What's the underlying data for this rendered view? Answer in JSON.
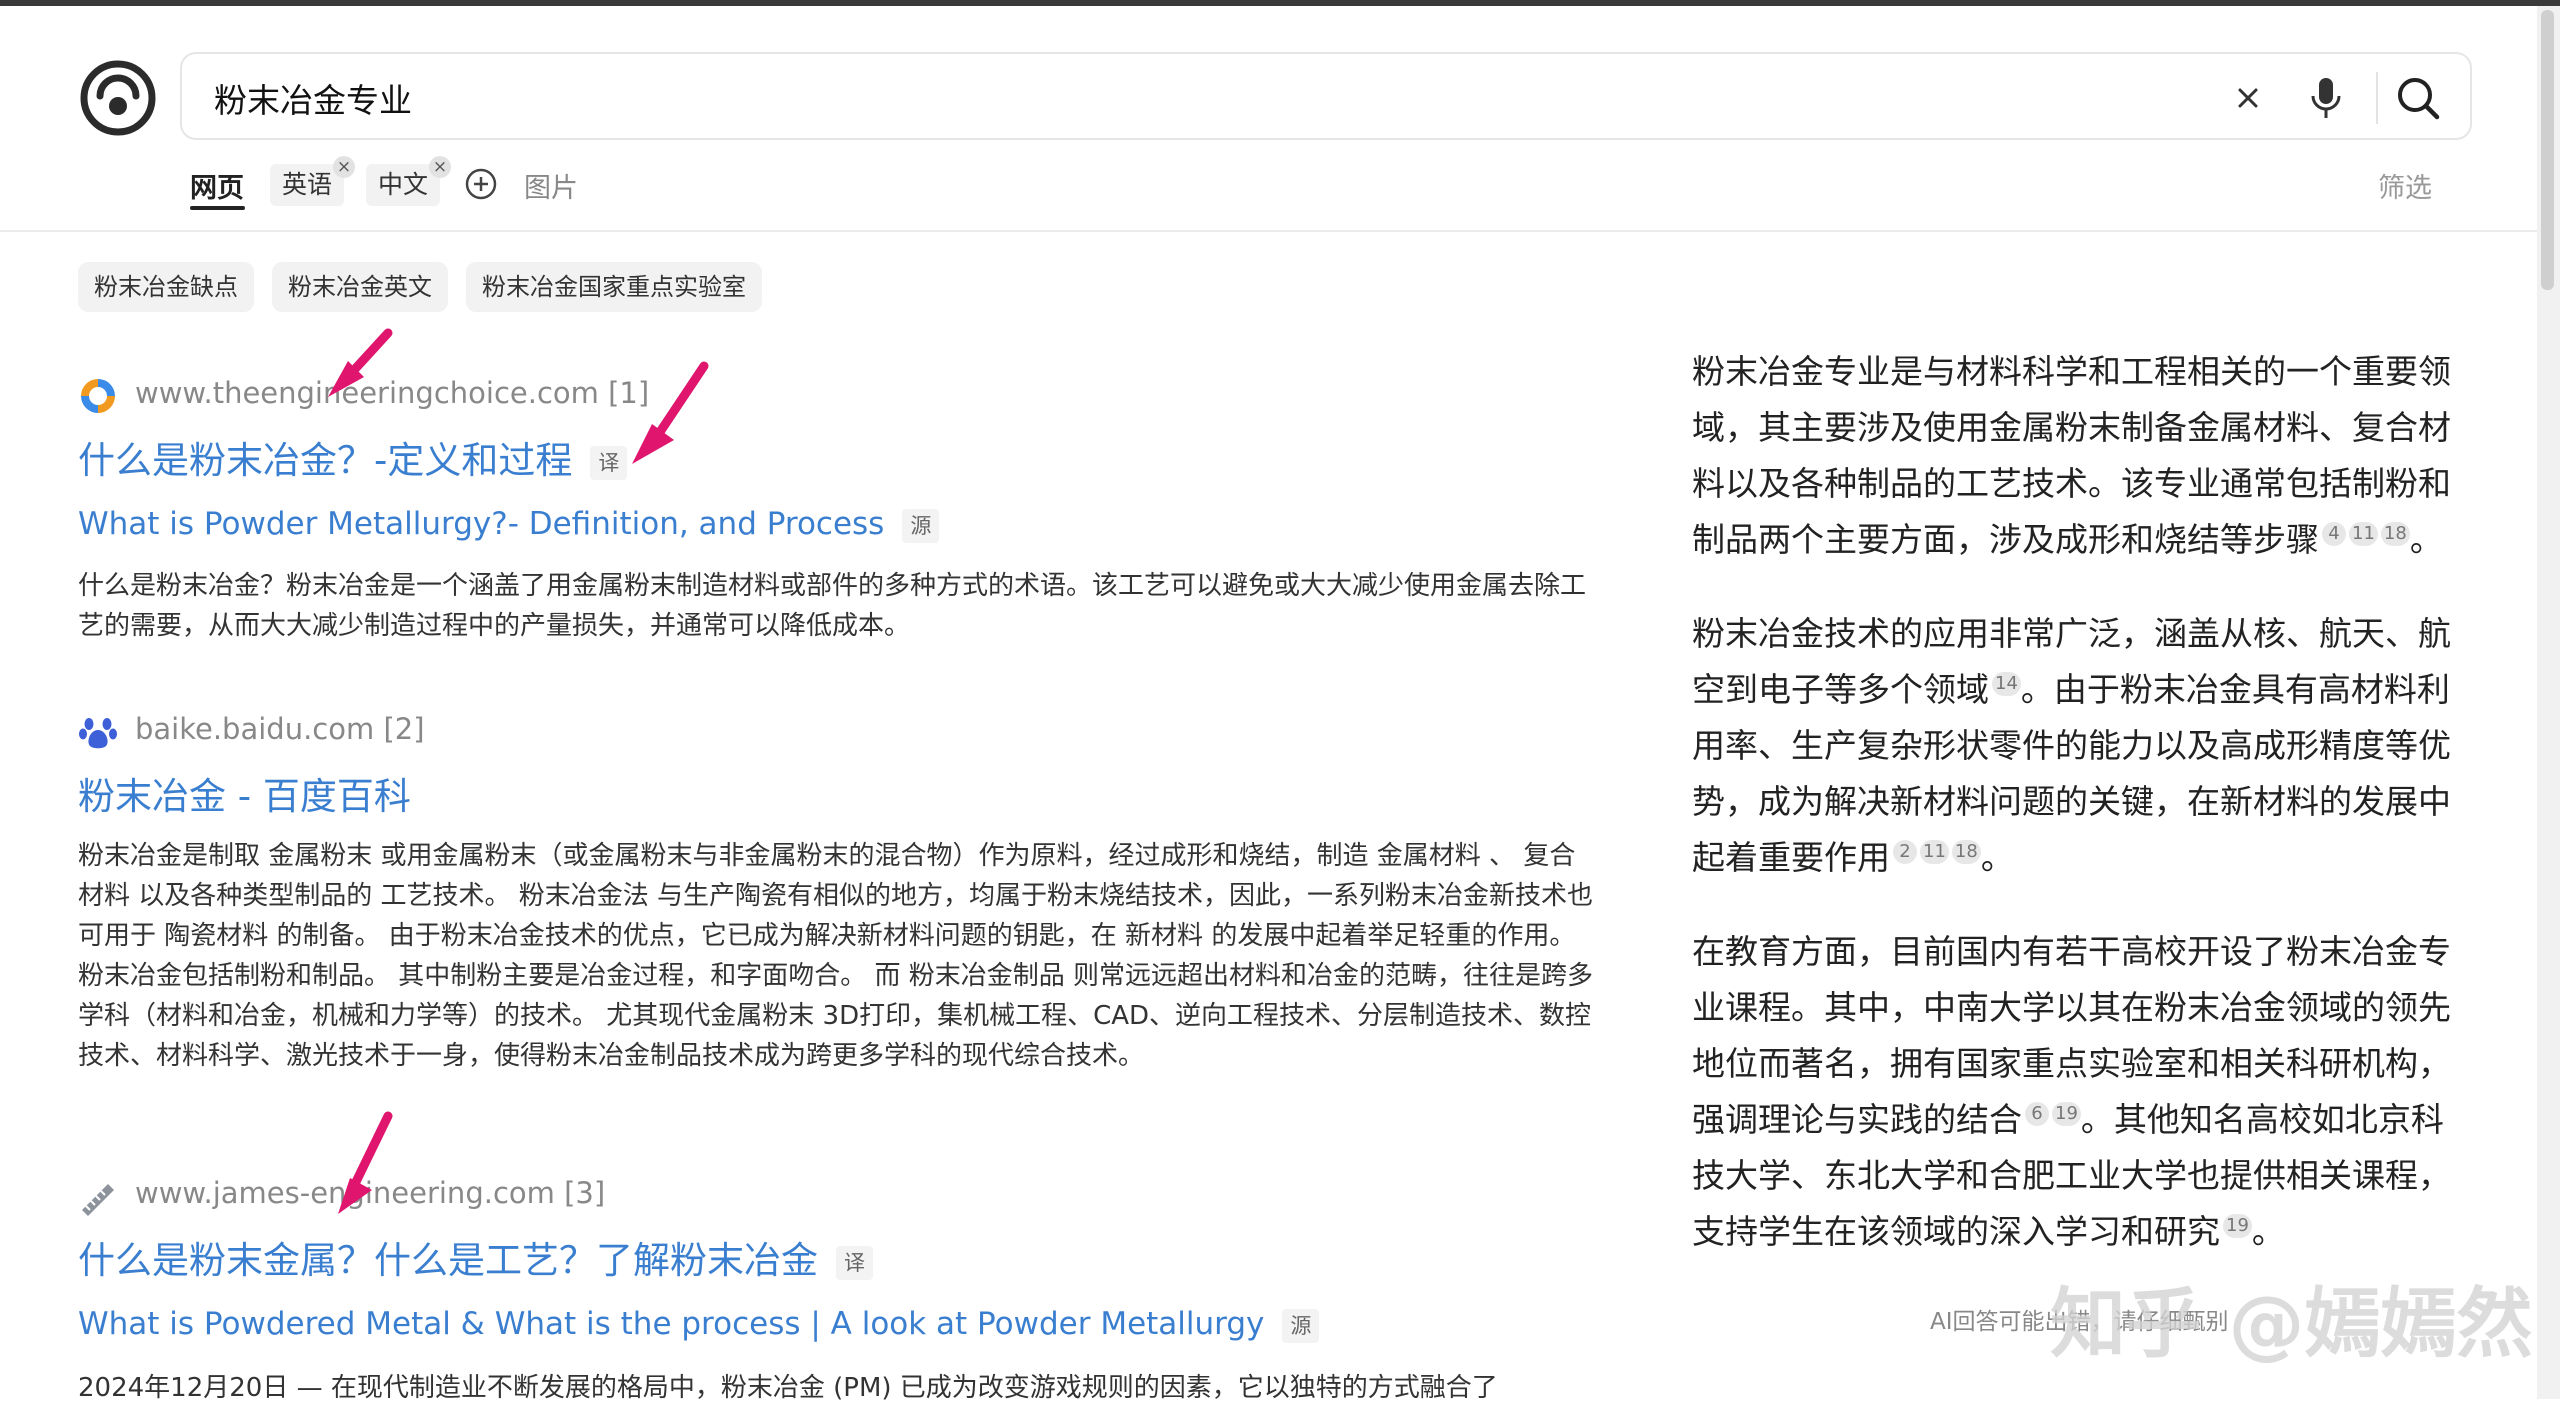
{
  "search": {
    "query": "粉末冶金专业"
  },
  "tabs": {
    "web": "网页",
    "english": "英语",
    "chinese": "中文",
    "images": "图片",
    "filter": "筛选",
    "remove": "×"
  },
  "related": [
    "粉末冶金缺点",
    "粉末冶金英文",
    "粉末冶金国家重点实验室"
  ],
  "results": [
    {
      "source": "www.theengineeringchoice.com [1]",
      "title": "什么是粉末冶金？-定义和过程",
      "title_badge": "译",
      "subtitle": "What is Powder Metallurgy?- Definition, and Process",
      "subtitle_badge": "源",
      "snippet": "什么是粉末冶金？粉末冶金是一个涵盖了用金属粉末制造材料或部件的多种方式的术语。该工艺可以避免或大大减少使用金属去除工艺的需要，从而大大减少制造过程中的产量损失，并通常可以降低成本。"
    },
    {
      "source": "baike.baidu.com [2]",
      "title": "粉末冶金 - 百度百科",
      "snippet": "粉末冶金是制取 金属粉末 或用金属粉末（或金属粉末与非金属粉末的混合物）作为原料，经过成形和烧结，制造 金属材料 、 复合材料 以及各种类型制品的 工艺技术。 粉末冶金法 与生产陶瓷有相似的地方，均属于粉末烧结技术，因此，一系列粉末冶金新技术也可用于 陶瓷材料 的制备。 由于粉末冶金技术的优点，它已成为解决新材料问题的钥匙，在 新材料 的发展中起着举足轻重的作用。 粉末冶金包括制粉和制品。 其中制粉主要是冶金过程，和字面吻合。 而 粉末冶金制品 则常远远超出材料和冶金的范畴，往往是跨多学科（材料和冶金，机械和力学等）的技术。 尤其现代金属粉末 3D打印，集机械工程、CAD、逆向工程技术、分层制造技术、数控技术、材料科学、激光技术于一身，使得粉末冶金制品技术成为跨更多学科的现代综合技术。"
    },
    {
      "source": "www.james-engineering.com [3]",
      "title": "什么是粉末金属？什么是工艺？了解粉末冶金",
      "title_badge": "译",
      "subtitle": "What is Powdered Metal & What is the process | A look at Powder Metallurgy",
      "subtitle_badge": "源",
      "snippet": "2024年12月20日 — 在现代制造业不断发展的格局中，粉末冶金 (PM) 已成为改变游戏规则的因素，它以独特的方式融合了"
    }
  ],
  "ai_answer": {
    "p1": {
      "text": "粉末冶金专业是与材料科学和工程相关的一个重要领域，其主要涉及使用金属粉末制备金属材料、复合材料以及各种制品的工艺技术。该专业通常包括制粉和制品两个主要方面，涉及成形和烧结等步骤",
      "cites": [
        "4",
        "11",
        "18"
      ],
      "end": "。"
    },
    "p2": {
      "text1": "粉末冶金技术的应用非常广泛，涵盖从核、航天、航空到电子等多个领域",
      "cite1": "14",
      "text2": "。由于粉末冶金具有高材料利用率、生产复杂形状零件的能力以及高成形精度等优势，成为解决新材料问题的关键，在新材料的发展中起着重要作用",
      "cites2": [
        "2",
        "11",
        "18"
      ],
      "end": "。"
    },
    "p3": {
      "text1": "在教育方面，目前国内有若干高校开设了粉末冶金专业课程。其中，中南大学以其在粉末冶金领域的领先地位而著名，拥有国家重点实验室和相关科研机构，强调理论与实践的结合",
      "cites1": [
        "6",
        "19"
      ],
      "text2": "。其他知名高校如北京科技大学、东北大学和合肥工业大学也提供相关课程，支持学生在该领域的深入学习和研究",
      "cite2": "19",
      "end": "。"
    },
    "note": "AI回答可能出错，请仔细甄别"
  },
  "watermark": "知乎 @嫣嫣然",
  "colors": {
    "link": "#3a7ed0",
    "arrow": "#e0156e"
  }
}
